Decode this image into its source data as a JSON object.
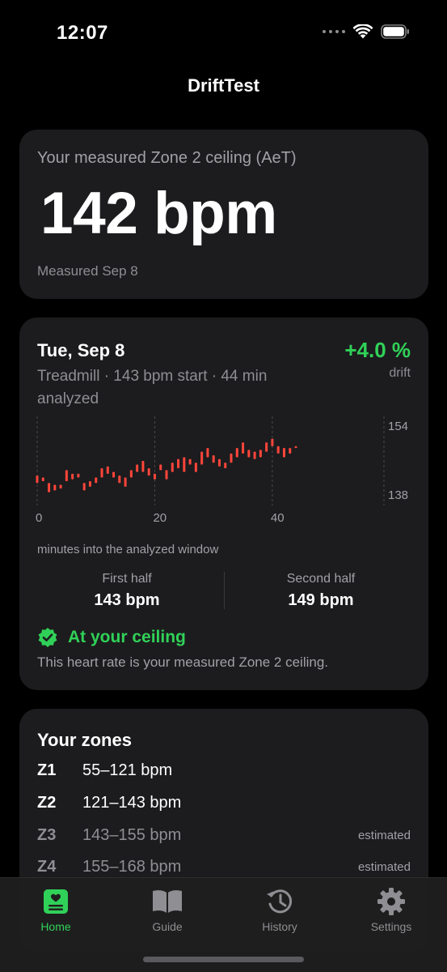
{
  "status_bar": {
    "time": "12:07"
  },
  "nav": {
    "title": "DriftTest"
  },
  "ceiling": {
    "label": "Your measured Zone 2 ceiling (AeT)",
    "value": "142 bpm",
    "measured": "Measured Sep 8"
  },
  "session": {
    "date": "Tue, Sep 8",
    "description": "Treadmill · 143 bpm start · 44 min analyzed",
    "drift_value": "+4.0 %",
    "drift_label": "drift",
    "chart_caption": "minutes into the analyzed window",
    "first_half": {
      "label": "First half",
      "value": "143 bpm"
    },
    "second_half": {
      "label": "Second half",
      "value": "149 bpm"
    },
    "status": "At your ceiling",
    "status_note": "This heart rate is your measured Zone 2 ceiling."
  },
  "chart_data": {
    "type": "bar",
    "x_ticks": [
      "0",
      "20",
      "40"
    ],
    "y_ticks": [
      "154",
      "138"
    ],
    "xlim": [
      0,
      44
    ],
    "ylim": [
      135,
      157
    ],
    "bar_color": "#ff453a",
    "ranges": [
      [
        140,
        142
      ],
      [
        140.5,
        141.5
      ],
      [
        137.5,
        140
      ],
      [
        138,
        139.5
      ],
      [
        138.5,
        139.5
      ],
      [
        140.5,
        143.5
      ],
      [
        141,
        142.5
      ],
      [
        141.5,
        142.5
      ],
      [
        138,
        140
      ],
      [
        139,
        140.5
      ],
      [
        140,
        141.5
      ],
      [
        141.5,
        144
      ],
      [
        142.5,
        144.5
      ],
      [
        141.5,
        143
      ],
      [
        140,
        142
      ],
      [
        139,
        141.5
      ],
      [
        141.5,
        143.5
      ],
      [
        143,
        145
      ],
      [
        143,
        146
      ],
      [
        142,
        144
      ],
      [
        141,
        142.5
      ],
      [
        143.5,
        145
      ],
      [
        141,
        143.5
      ],
      [
        143,
        145.5
      ],
      [
        144,
        146.5
      ],
      [
        143,
        147
      ],
      [
        145,
        146.5
      ],
      [
        143,
        145.5
      ],
      [
        145,
        148.5
      ],
      [
        147,
        149.5
      ],
      [
        145.5,
        147.5
      ],
      [
        144.5,
        146.5
      ],
      [
        144,
        145.5
      ],
      [
        145.5,
        148
      ],
      [
        147,
        149.5
      ],
      [
        148,
        151
      ],
      [
        147,
        149
      ],
      [
        146.5,
        148.5
      ],
      [
        147,
        149
      ],
      [
        148.5,
        151
      ],
      [
        150,
        152
      ],
      [
        148,
        150
      ],
      [
        147,
        149.5
      ],
      [
        148,
        149.5
      ],
      [
        149.5,
        150
      ]
    ]
  },
  "zones": {
    "title": "Your zones",
    "items": [
      {
        "code": "Z1",
        "range": "55–121 bpm",
        "note": ""
      },
      {
        "code": "Z2",
        "range": "121–143 bpm",
        "note": ""
      },
      {
        "code": "Z3",
        "range": "143–155 bpm",
        "note": "estimated"
      },
      {
        "code": "Z4",
        "range": "155–168 bpm",
        "note": "estimated"
      }
    ]
  },
  "tabs": [
    {
      "label": "Home",
      "icon": "home-heart-icon",
      "active": true
    },
    {
      "label": "Guide",
      "icon": "book-icon",
      "active": false
    },
    {
      "label": "History",
      "icon": "history-clock-icon",
      "active": false
    },
    {
      "label": "Settings",
      "icon": "gear-icon",
      "active": false
    }
  ],
  "colors": {
    "accent": "#30d158",
    "chart": "#ff453a",
    "card": "#1c1c1e"
  }
}
